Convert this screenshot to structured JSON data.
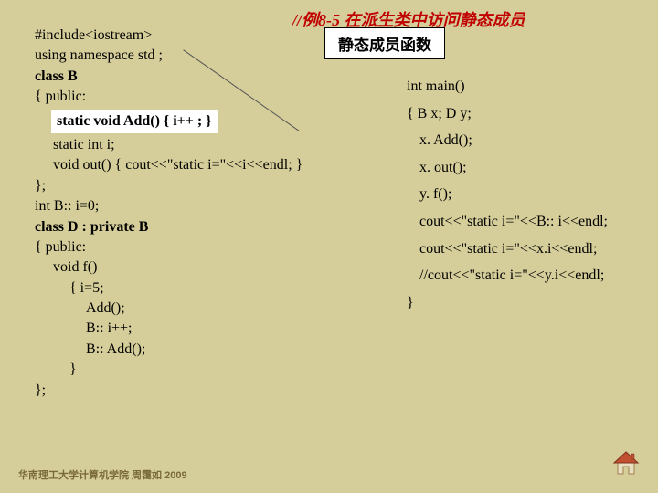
{
  "title": "//例8-5  在派生类中访问静态成员",
  "callout": "静态成员函数",
  "left": {
    "l1": "#include<iostream>",
    "l2": "using namespace std ;",
    "l3": "class B",
    "l4": "{ public:",
    "highlight": "static void Add() { i++ ; }",
    "l5": "static int i;",
    "l6": "void out() { cout<<\"static i=\"<<i<<endl; }",
    "l7": "};",
    "l8": "int B:: i=0;",
    "l9": "class D : private B",
    "l10": "{ public:",
    "l11": "void f()",
    "l12": "{ i=5;",
    "l13": "Add();",
    "l14": "B:: i++;",
    "l15": "B:: Add();",
    "l16": "}",
    "l17": "};"
  },
  "right": {
    "r1": "int main()",
    "r2": "{ B x;  D y;",
    "r3": "x. Add();",
    "r4": "x. out();",
    "r5": "y. f();",
    "r6": "cout<<\"static i=\"<<B:: i<<endl;",
    "r7": "cout<<\"static i=\"<<x.i<<endl;",
    "r8": "//cout<<\"static i=\"<<y.i<<endl;",
    "r9": "}"
  },
  "footer": "华南理工大学计算机学院 周霭如 2009",
  "home_icon_label": "home-icon"
}
